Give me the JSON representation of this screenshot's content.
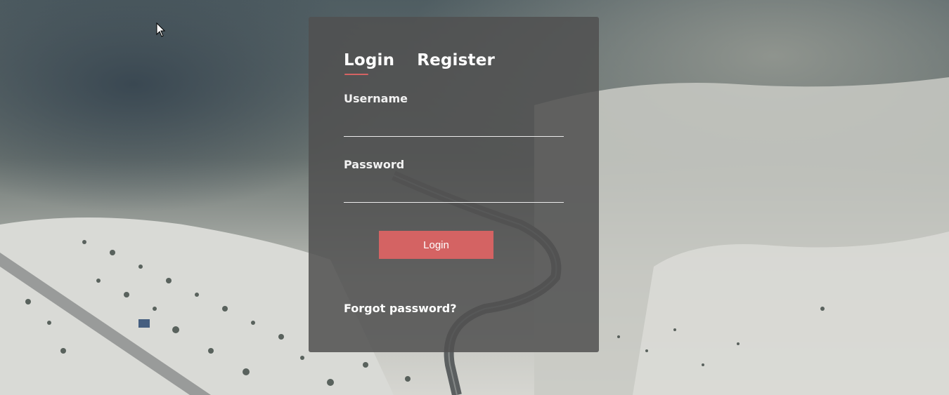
{
  "tabs": {
    "login_label": "Login",
    "register_label": "Register",
    "active": "login"
  },
  "form": {
    "username_label": "Username",
    "username_value": "",
    "password_label": "Password",
    "password_value": "",
    "submit_label": "Login",
    "forgot_label": "Forgot password?"
  },
  "colors": {
    "accent": "#d46363",
    "card_background": "#505050",
    "text": "#ffffff"
  },
  "icons": {
    "cursor": "mouse-pointer-icon"
  }
}
